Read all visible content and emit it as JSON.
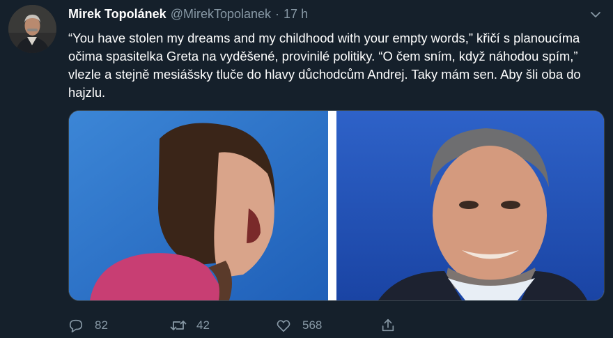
{
  "tweet": {
    "author_name": "Mirek Topolánek",
    "author_handle": "@MirekTopolanek",
    "separator": "·",
    "timestamp": "17 h",
    "text": "“You have stolen my dreams and my childhood with your empty words,” křičí s planoucíma očima spasitelka Greta na vyděšené, provinilé politiky. “O čem sním, když náhodou spím,”  vlezle a stejně mesiášsky tluče do hlavy důchodcům Andrej. Taky mám sen. Aby šli oba do hajzlu."
  },
  "actions": {
    "reply_count": "82",
    "retweet_count": "42",
    "like_count": "568"
  },
  "icons": {
    "more": "chevron-down-icon",
    "reply": "speech-bubble-icon",
    "retweet": "retweet-arrows-icon",
    "like": "heart-icon",
    "share": "share-upload-icon"
  },
  "colors": {
    "background": "#15202b",
    "secondary_text": "#8899a6",
    "border": "#38444d"
  }
}
